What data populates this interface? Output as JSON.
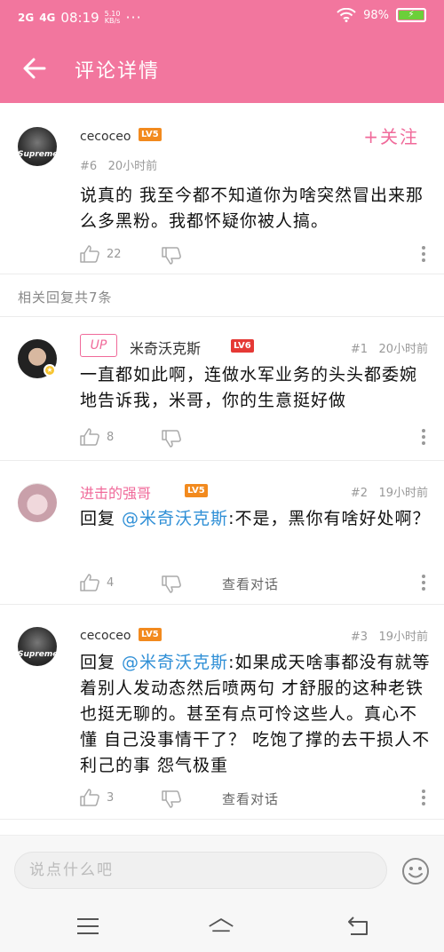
{
  "status_bar": {
    "signal_1": "2G",
    "signal_2": "4G",
    "time": "08:19",
    "net_speed_value": "5.10",
    "net_speed_unit": "KB/s",
    "more": "···",
    "battery": "98%"
  },
  "app_bar": {
    "title": "评论详情"
  },
  "main_comment": {
    "user": "cecoceo",
    "level": "LV5",
    "follow_label": "+关注",
    "floor": "#6",
    "time": "20小时前",
    "text": "说真的 我至今都不知道你为啥突然冒出来那么多黑粉。我都怀疑你被人搞。",
    "likes": "22"
  },
  "replies_label": "相关回复共7条",
  "replies": [
    {
      "badge": "UP",
      "user": "米奇沃克斯",
      "level": "LV6",
      "floor": "#1",
      "time": "20小时前",
      "text": "一直都如此啊，连做水军业务的头头都委婉地告诉我，米哥，你的生意挺好做",
      "likes": "8"
    },
    {
      "user": "进击的强哥",
      "level": "LV5",
      "floor": "#2",
      "time": "19小时前",
      "prefix": "回复 ",
      "mention": "@米奇沃克斯",
      "text": ":不是，黑你有啥好处啊？",
      "likes": "4",
      "view_conversation": "查看对话"
    },
    {
      "user": "cecoceo",
      "level": "LV5",
      "floor": "#3",
      "time": "19小时前",
      "prefix": "回复 ",
      "mention": "@米奇沃克斯",
      "text": ":如果成天啥事都没有就等着别人发动态然后喷两句 才舒服的这种老铁 也挺无聊的。甚至有点可怜这些人。真心不懂 自己没事情干了？ 吃饱了撑的去干损人不利己的事 怨气极重",
      "likes": "3",
      "view_conversation": "查看对话"
    }
  ],
  "avatar_text": "Supreme",
  "input": {
    "placeholder": "说点什么吧"
  },
  "colors": {
    "accent": "#f2769e",
    "mention": "#2f8fd6",
    "level": "#f28a1e"
  }
}
